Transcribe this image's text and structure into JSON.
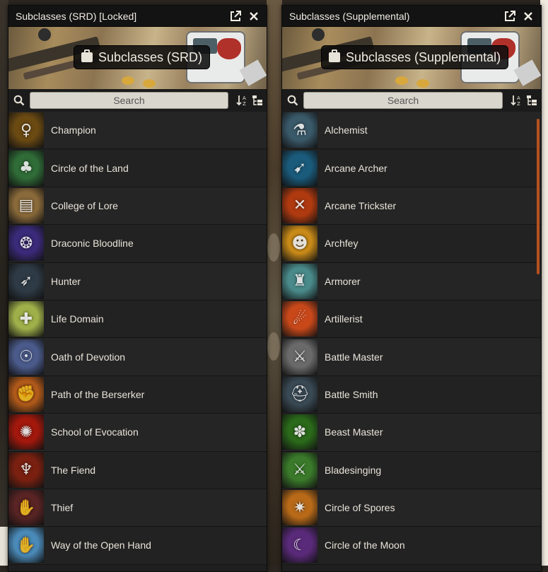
{
  "colors": {
    "accent_scroll": "#b5511e",
    "window_bg": "#1f1f1f",
    "search_bg": "#d9d6ce"
  },
  "windows": [
    {
      "title": "Subclasses (SRD) [Locked]",
      "banner_label": "Subclasses (SRD)",
      "search_placeholder": "Search",
      "items": [
        {
          "label": "Champion",
          "icon": "champion-icon",
          "bg": "#6b4a12",
          "glyph": "♀"
        },
        {
          "label": "Circle of the Land",
          "icon": "tree-icon",
          "bg": "#2f6c37",
          "glyph": "♣"
        },
        {
          "label": "College of Lore",
          "icon": "book-icon",
          "bg": "#8a6a3a",
          "glyph": "▤"
        },
        {
          "label": "Draconic Bloodline",
          "icon": "dragon-icon",
          "bg": "#3a2a7a",
          "glyph": "❂"
        },
        {
          "label": "Hunter",
          "icon": "arrow-icon",
          "bg": "#2e3a45",
          "glyph": "➶"
        },
        {
          "label": "Life Domain",
          "icon": "shield-cross-icon",
          "bg": "#9fb04a",
          "glyph": "✚"
        },
        {
          "label": "Oath of Devotion",
          "icon": "saint-icon",
          "bg": "#4a5a8a",
          "glyph": "☉"
        },
        {
          "label": "Path of the Berserker",
          "icon": "chain-fist-icon",
          "bg": "#b25a1a",
          "glyph": "✊"
        },
        {
          "label": "School of Evocation",
          "icon": "fire-swirl-icon",
          "bg": "#a2180c",
          "glyph": "✺"
        },
        {
          "label": "The Fiend",
          "icon": "demon-icon",
          "bg": "#7a2010",
          "glyph": "♆"
        },
        {
          "label": "Thief",
          "icon": "glove-icon",
          "bg": "#5a2424",
          "glyph": "✋"
        },
        {
          "label": "Way of the Open Hand",
          "icon": "open-hand-icon",
          "bg": "#4a8ab8",
          "glyph": "✋"
        }
      ]
    },
    {
      "title": "Subclasses (Supplemental)",
      "banner_label": "Subclasses (Supplemental)",
      "search_placeholder": "Search",
      "items": [
        {
          "label": "Alchemist",
          "icon": "potions-icon",
          "bg": "#3a5a6a",
          "glyph": "⚗"
        },
        {
          "label": "Arcane Archer",
          "icon": "bow-icon",
          "bg": "#1a5a7a",
          "glyph": "➹"
        },
        {
          "label": "Arcane Trickster",
          "icon": "crossed-blades-icon",
          "bg": "#b03a10",
          "glyph": "✕"
        },
        {
          "label": "Archfey",
          "icon": "pumpkin-icon",
          "bg": "#c88a18",
          "glyph": "☻"
        },
        {
          "label": "Armorer",
          "icon": "armor-icon",
          "bg": "#4a8a8a",
          "glyph": "♜"
        },
        {
          "label": "Artillerist",
          "icon": "cannon-fire-icon",
          "bg": "#c8481a",
          "glyph": "☄"
        },
        {
          "label": "Battle Master",
          "icon": "crossed-swords-icon",
          "bg": "#6a6a6a",
          "glyph": "⚔"
        },
        {
          "label": "Battle Smith",
          "icon": "helmet-icon",
          "bg": "#3a4a55",
          "glyph": "⛑"
        },
        {
          "label": "Beast Master",
          "icon": "paw-icon",
          "bg": "#2a6a1a",
          "glyph": "✽"
        },
        {
          "label": "Bladesinging",
          "icon": "blade-icon",
          "bg": "#3a7a2a",
          "glyph": "⚔"
        },
        {
          "label": "Circle of Spores",
          "icon": "spores-icon",
          "bg": "#b86a18",
          "glyph": "✷"
        },
        {
          "label": "Circle of the Moon",
          "icon": "moon-icon",
          "bg": "#5a2a7a",
          "glyph": "☾"
        }
      ]
    }
  ]
}
